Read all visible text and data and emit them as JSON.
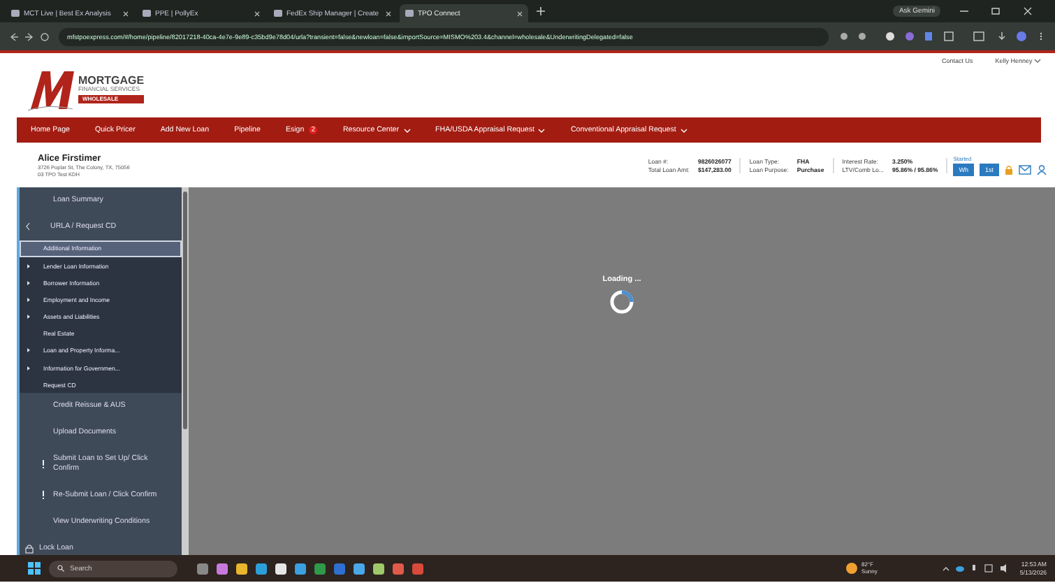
{
  "browser": {
    "tabs": [
      {
        "title": "MCT Live | Best Ex Analysis",
        "selected": false
      },
      {
        "title": "PPE | PollyEx",
        "selected": false
      },
      {
        "title": "FedEx Ship Manager | Create",
        "selected": false
      },
      {
        "title": "TPO Connect",
        "selected": true
      }
    ],
    "ask_gemini": "Ask Gemini",
    "url": "mfstpoexpress.com/#/home/pipeline/82017218-40ca-4e7e-9e89-c35bd9e78d04/urla?transient=false&newloan=false&importSource=MISMO%203.4&channel=wholesale&UnderwritingDelegated=false"
  },
  "page": {
    "top_links": [
      "Contact Us",
      "Kelly Henney"
    ],
    "logo": {
      "brand": "MORTGAGE",
      "tagline": "FINANCIAL SERVICES",
      "sub": "WHOLESALE"
    },
    "nav": [
      {
        "label": "Home Page",
        "dropdown": false
      },
      {
        "label": "Quick Pricer",
        "dropdown": false
      },
      {
        "label": "Add New Loan",
        "dropdown": false
      },
      {
        "label": "Pipeline",
        "dropdown": false
      },
      {
        "label": "Esign",
        "badge": "2",
        "dropdown": false
      },
      {
        "label": "Resource Center",
        "dropdown": true
      },
      {
        "label": "FHA/USDA Appraisal Request",
        "dropdown": true
      },
      {
        "label": "Conventional Appraisal Request",
        "dropdown": true
      }
    ],
    "loan": {
      "borrower": "Alice Firstimer",
      "address": "3726 Poplar St, The Colony, TX, 75056",
      "branch": "03 TPO Test KDH",
      "fields": [
        [
          {
            "label": "Loan #:",
            "value": "9826026077"
          },
          {
            "label": "Total Loan Amt:",
            "value": "$147,283.00"
          }
        ],
        [
          {
            "label": "Loan Type:",
            "value": "FHA"
          },
          {
            "label": "Loan Purpose:",
            "value": "Purchase"
          }
        ],
        [
          {
            "label": "Interest Rate:",
            "value": "3.250%"
          },
          {
            "label": "LTV/Comb Lo...",
            "value": "95.86% / 95.86%"
          }
        ]
      ],
      "status": "Started",
      "status_buttons": [
        "Wh",
        "1st"
      ]
    },
    "sidebar": [
      {
        "label": "Loan Summary",
        "kind": "item",
        "warning": false
      },
      {
        "label": "URLA / Request CD",
        "kind": "group",
        "expanded": true,
        "children": [
          {
            "label": "Additional Information",
            "selected": true,
            "has_children": false
          },
          {
            "label": "Lender Loan Information",
            "selected": false,
            "has_children": true
          },
          {
            "label": "Borrower Information",
            "selected": false,
            "has_children": true
          },
          {
            "label": "Employment and Income",
            "selected": false,
            "has_children": true
          },
          {
            "label": "Assets and Liabilities",
            "selected": false,
            "has_children": true
          },
          {
            "label": "Real Estate",
            "selected": false,
            "has_children": false
          },
          {
            "label": "Loan and Property Informa...",
            "selected": false,
            "has_children": true
          },
          {
            "label": "Information for Governmen...",
            "selected": false,
            "has_children": true
          },
          {
            "label": "Request CD",
            "selected": false,
            "has_children": false
          }
        ]
      },
      {
        "label": "Credit Reissue & AUS",
        "kind": "item",
        "warning": false
      },
      {
        "label": "Upload Documents",
        "kind": "item",
        "warning": false
      },
      {
        "label": "Submit Loan to Set Up/ Click Confirm",
        "kind": "item",
        "warning": true
      },
      {
        "label": "Re-Submit Loan / Click Confirm",
        "kind": "item",
        "warning": true
      },
      {
        "label": "View Underwriting Conditions",
        "kind": "item",
        "warning": false
      },
      {
        "label": "Lock Loan",
        "kind": "lock"
      }
    ],
    "loading": "Loading ..."
  },
  "taskbar": {
    "search_placeholder": "Search",
    "weather": {
      "temp": "82°F",
      "condition": "Sunny"
    },
    "time": "12:53 AM",
    "date": "5/13/2026"
  }
}
